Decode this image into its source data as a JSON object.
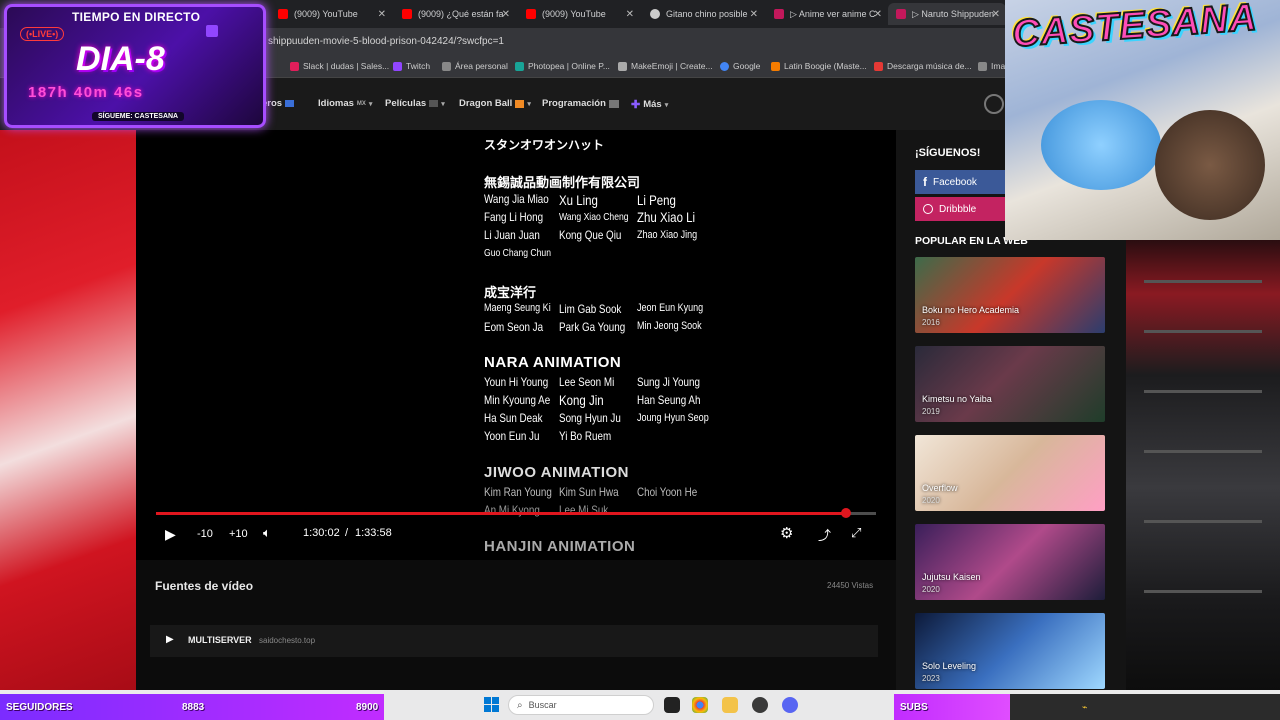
{
  "browser": {
    "tabs": [
      {
        "label": "(9009) YouTube",
        "icon": "youtube-icon",
        "color": "#ff0000"
      },
      {
        "label": "(9009) ¿Qué están fa",
        "icon": "youtube-icon",
        "color": "#ff0000"
      },
      {
        "label": "(9009) YouTube",
        "icon": "youtube-icon",
        "color": "#ff0000"
      },
      {
        "label": "Gitano chino posible",
        "icon": "globe-icon",
        "color": "#cccccc"
      },
      {
        "label": "▷ Anime ver anime C",
        "icon": "anime-site-icon",
        "color": "#c2185b"
      },
      {
        "label": "▷ Naruto Shippuden",
        "icon": "anime-site-icon",
        "color": "#c2185b"
      }
    ],
    "url": "shippuuden-movie-5-blood-prison-042424/?swcfpc=1",
    "bookmarks": [
      {
        "label": "Slack | dudas | Sales...",
        "color": "#e01e5a"
      },
      {
        "label": "Twitch",
        "color": "#9146ff"
      },
      {
        "label": "Área personal",
        "color": "#888888"
      },
      {
        "label": "Photopea | Online P...",
        "color": "#18a497"
      },
      {
        "label": "MakeEmoji | Create...",
        "color": "#aaaaaa"
      },
      {
        "label": "Google",
        "color": "#4285f4"
      },
      {
        "label": "Latin Boogie (Maste...",
        "color": "#f57c00"
      },
      {
        "label": "Descarga música de...",
        "color": "#e53935"
      },
      {
        "label": "Ima",
        "color": "#888888"
      }
    ]
  },
  "site": {
    "nav": [
      {
        "label": "eros",
        "caret": ""
      },
      {
        "label": "Idiomas",
        "suffix": "MX",
        "caret": "▾"
      },
      {
        "label": "Películas",
        "caret": "▾"
      },
      {
        "label": "Dragon Ball",
        "caret": "▾"
      },
      {
        "label": "Programación",
        "caret": ""
      },
      {
        "label": "Más",
        "caret": "▾"
      }
    ]
  },
  "video": {
    "credits": {
      "line_top": "スタンオワオンハット",
      "studio1": "無錫誠品動画制作有限公司",
      "studio1_names": [
        "Wang Jia Miao",
        "Xu Ling",
        "Li Peng",
        "Fang Li Hong",
        "Wang Xiao Cheng",
        "Zhu Xiao Li",
        "Li Juan Juan",
        "Kong Que Qiu",
        "Zhao Xiao Jing",
        "Guo Chang Chun"
      ],
      "studio2": "成宝洋行",
      "studio2_names": [
        "Maeng Seung Ki",
        "Lim Gab Sook",
        "Jeon Eun Kyung",
        "Eom Seon Ja",
        "Park Ga Young",
        "Min Jeong Sook"
      ],
      "studio3": "NARA ANIMATION",
      "studio3_names": [
        "Youn Hi Young",
        "Lee Seon Mi",
        "Sung Ji Young",
        "Min Kyoung Ae",
        "Kong Jin",
        "Han Seung Ah",
        "Ha Sun Deak",
        "Song Hyun Ju",
        "Joung Hyun Seop",
        "Yoon Eun Ju",
        "Yi Bo Ruem"
      ],
      "studio4": "JIWOO ANIMATION",
      "studio4_names": [
        "Kim Ran Young",
        "Kim Sun Hwa",
        "Choi Yoon He",
        "An Mi Kyong",
        "Lee Mi Suk"
      ],
      "studio5": "HANJIN ANIMATION"
    },
    "controls": {
      "rewind": "-10",
      "forward": "+10",
      "current_time": "1:30:02",
      "separator": "/",
      "duration": "1:33:58",
      "progress": 0.958
    }
  },
  "sources": {
    "title": "Fuentes de vídeo",
    "views": "24450 Vistas",
    "server_name": "MULTISERVER",
    "server_host": "saidochesto.top"
  },
  "sidebar": {
    "follow_title": "¡SÍGUENOS!",
    "social": [
      {
        "label": "Facebook",
        "icon": "facebook-icon",
        "color": "#3b5998"
      },
      {
        "label": "Dribbble",
        "icon": "dribbble-icon",
        "color": "#c32361"
      }
    ],
    "popular_title": "POPULAR EN LA WEB",
    "popular": [
      {
        "title": "Boku no Hero Academia",
        "year": "2016",
        "bg": "linear-gradient(135deg,#3d6b4a,#c8382a 50%,#2b3d6e)"
      },
      {
        "title": "Kimetsu no Yaiba",
        "year": "2019",
        "bg": "linear-gradient(135deg,#2a2a3a,#6a3a4a 45%,#1f3d2a)"
      },
      {
        "title": "Overflow",
        "year": "2020",
        "bg": "linear-gradient(135deg,#f1e6d8,#d8b79a 50%,#ff9fc4)"
      },
      {
        "title": "Jujutsu Kaisen",
        "year": "2020",
        "bg": "linear-gradient(135deg,#3a1f5a,#b04a8a 50%,#1d1d3a)"
      },
      {
        "title": "Solo Leveling",
        "year": "2023",
        "bg": "linear-gradient(135deg,#0d1a3a,#3a6fbf 50%,#9fd8ff)"
      }
    ]
  },
  "stream": {
    "title": "TIEMPO EN DIRECTO",
    "live": "(•LIVE•)",
    "day": "DIA-8",
    "uptime": "187h 40m 46s",
    "follow": "SÍGUEME: CASTESANA",
    "logo": "CASTESANA",
    "followers_label": "SEGUIDORES",
    "followers_value": "8883",
    "followers_goal": "8900",
    "subs_label": "SUBS",
    "subs_progress": 0.3
  },
  "taskbar": {
    "search_placeholder": "Buscar"
  }
}
